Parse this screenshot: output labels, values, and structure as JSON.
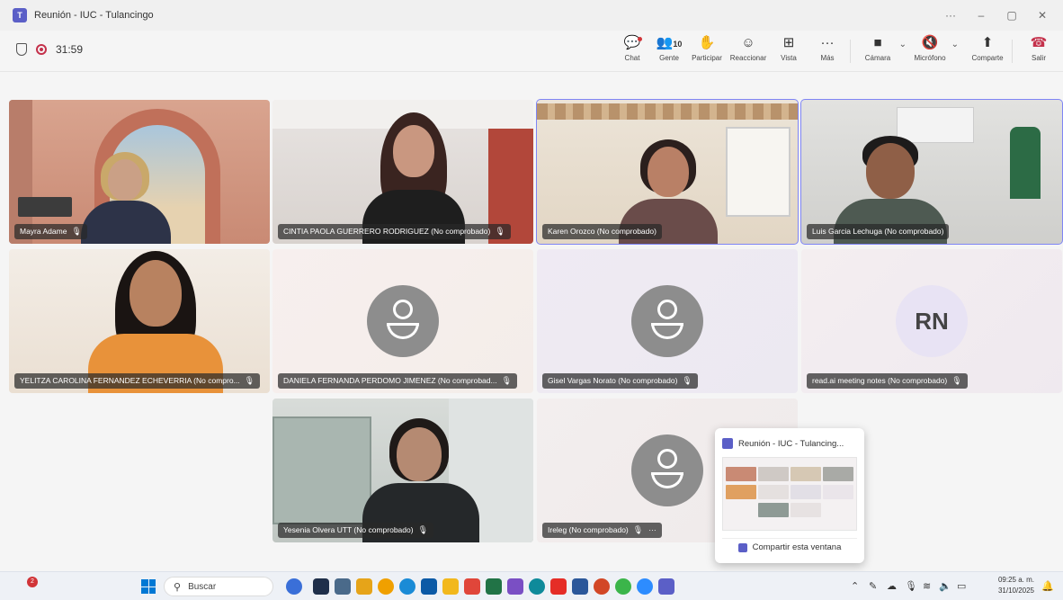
{
  "window": {
    "title": "Reunión - IUC - Tulancingo",
    "controls": [
      "···",
      "–",
      "▢",
      "✕"
    ]
  },
  "meeting": {
    "timer": "31:59"
  },
  "toolbar": {
    "chat": "Chat",
    "people": "Gente",
    "people_count": "10",
    "raise": "Participar",
    "react": "Reaccionar",
    "view": "Vista",
    "more": "Más",
    "camera": "Cámara",
    "mic": "Micrófono",
    "share": "Comparte",
    "leave": "Salir"
  },
  "participants": [
    {
      "name": "Mayra Adame",
      "type": "video",
      "active": false
    },
    {
      "name": "CINTIA PAOLA GUERRERO RODRIGUEZ (No comprobado)",
      "type": "video",
      "active": false
    },
    {
      "name": "Karen Orozco (No comprobado)",
      "type": "video",
      "active": true
    },
    {
      "name": "Luis Garcia Lechuga (No comprobado)",
      "type": "video",
      "active": true
    },
    {
      "name": "YELITZA CAROLINA FERNANDEZ ECHEVERRIA (No compro...",
      "type": "video",
      "active": false
    },
    {
      "name": "DANIELA FERNANDA PERDOMO JIMENEZ (No comprobad...",
      "type": "avatar",
      "active": false
    },
    {
      "name": "Gisel Vargas Norato (No comprobado)",
      "type": "avatar",
      "active": false
    },
    {
      "name": "read.ai meeting notes (No comprobado)",
      "type": "initials",
      "initials": "RN",
      "active": false
    },
    {
      "name": "Yesenia Olvera UTT (No comprobado)",
      "type": "video",
      "active": false
    },
    {
      "name": "Ireleg (No comprobado)",
      "type": "avatar",
      "active": false
    }
  ],
  "popup": {
    "title": "Reunión - IUC - Tulancing...",
    "share_label": "Compartir esta ventana"
  },
  "taskbar": {
    "search_placeholder": "Buscar",
    "widget_badge": "2",
    "time": "09:25 a. m.",
    "date": "31/10/2025"
  },
  "colors": {
    "accent": "#5b5fc7",
    "active_outline": "#7f85f5",
    "leave_red": "#c4314b"
  }
}
